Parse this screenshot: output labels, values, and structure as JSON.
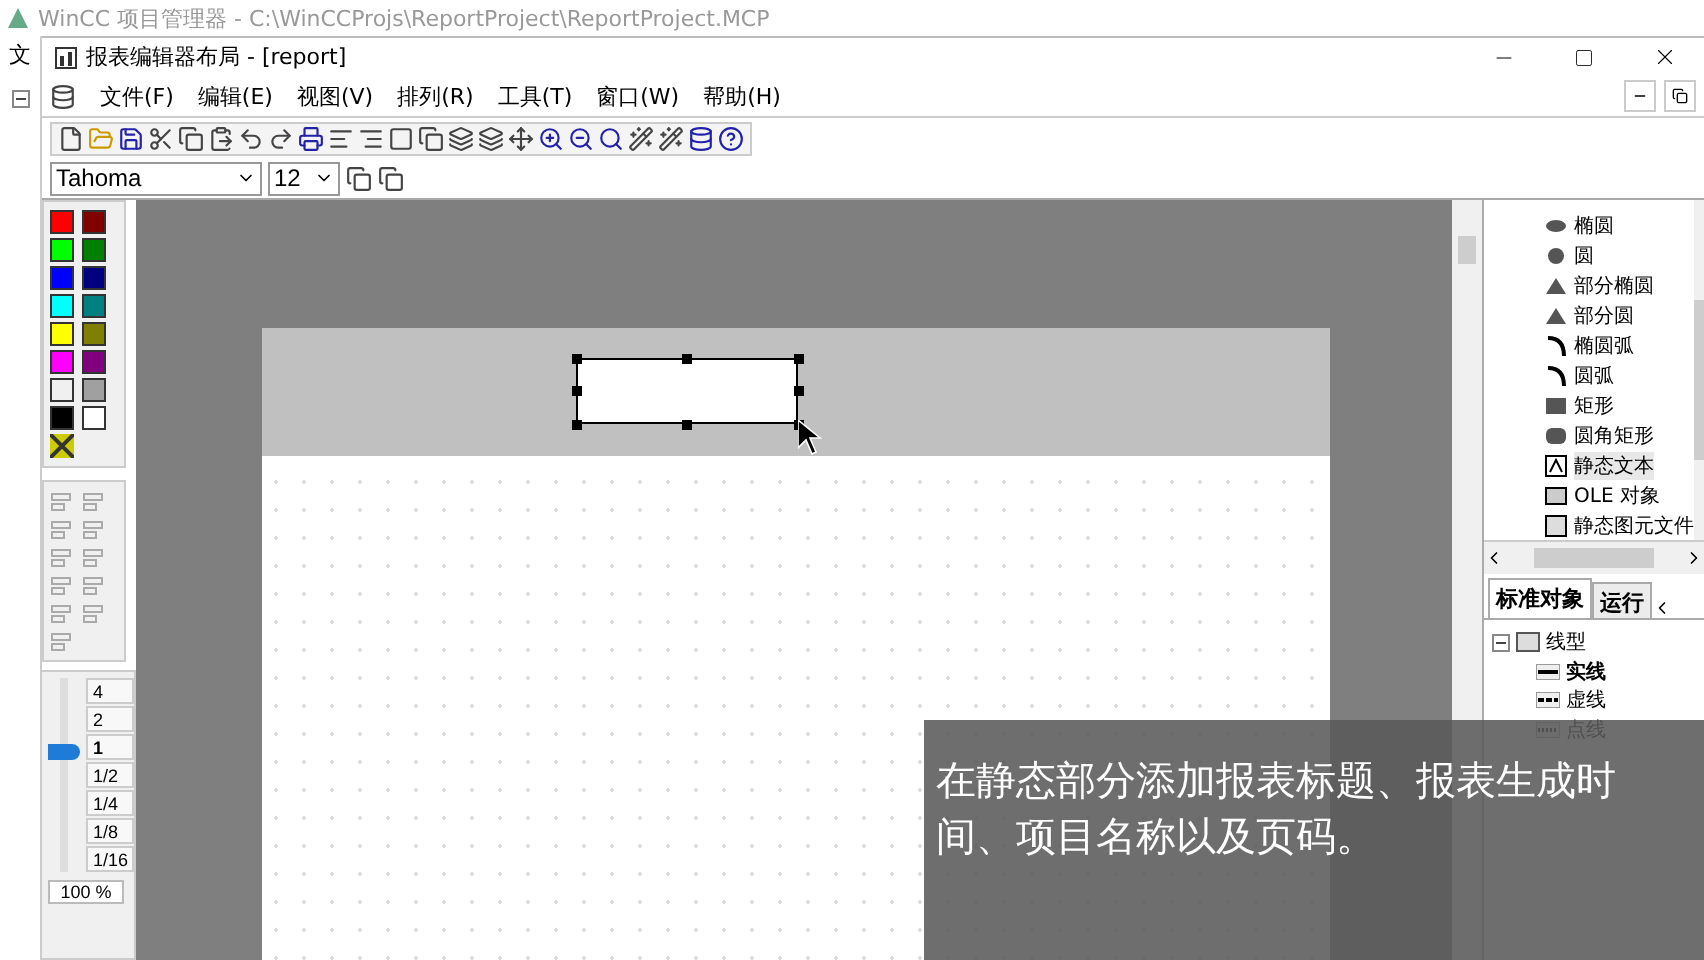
{
  "back_window": {
    "title": "WinCC 项目管理器 - C:\\WinCCProjs\\ReportProject\\ReportProject.MCP",
    "menu_fragment": "文"
  },
  "window": {
    "title": "报表编辑器布局 - [report]"
  },
  "menu": [
    "文件(F)",
    "编辑(E)",
    "视图(V)",
    "排列(R)",
    "工具(T)",
    "窗口(W)",
    "帮助(H)"
  ],
  "font_bar": {
    "font": "Tahoma",
    "size": "12"
  },
  "palette": [
    {
      "color": "#ff0000"
    },
    {
      "color": "#800000"
    },
    {
      "color": "#00ff00"
    },
    {
      "color": "#008000"
    },
    {
      "color": "#0000ff"
    },
    {
      "color": "#000080"
    },
    {
      "color": "#00ffff"
    },
    {
      "color": "#008080"
    },
    {
      "color": "#ffff00"
    },
    {
      "color": "#808000"
    },
    {
      "color": "#ff00ff"
    },
    {
      "color": "#800080"
    },
    {
      "color": "#f0f0f0"
    },
    {
      "color": "#a0a0a0"
    },
    {
      "color": "#000000"
    },
    {
      "color": "#ffffff"
    }
  ],
  "zoom": {
    "steps": [
      {
        "label": "4",
        "selected": false
      },
      {
        "label": "2",
        "selected": false
      },
      {
        "label": "1",
        "selected": true
      },
      {
        "label": "1/2",
        "selected": false
      },
      {
        "label": "1/4",
        "selected": false
      },
      {
        "label": "1/8",
        "selected": false
      },
      {
        "label": "1/16",
        "selected": false
      }
    ],
    "reading": "100 %"
  },
  "object_tree": [
    {
      "label": "椭圆",
      "selected": false
    },
    {
      "label": "圆",
      "selected": false
    },
    {
      "label": "部分椭圆",
      "selected": false
    },
    {
      "label": "部分圆",
      "selected": false
    },
    {
      "label": "椭圆弧",
      "selected": false
    },
    {
      "label": "圆弧",
      "selected": false
    },
    {
      "label": "矩形",
      "selected": false
    },
    {
      "label": "圆角矩形",
      "selected": false
    },
    {
      "label": "静态文本",
      "selected": true
    },
    {
      "label": "OLE 对象",
      "selected": false
    },
    {
      "label": "静态图元文件",
      "selected": false
    }
  ],
  "tabs": [
    {
      "label": "标准对象",
      "selected": true
    },
    {
      "label": "运行",
      "selected": false
    }
  ],
  "line_tree": [
    {
      "label": "线型",
      "expanded": true,
      "children": [
        {
          "label": "实线",
          "selected": true
        },
        {
          "label": "虚线",
          "selected": false
        },
        {
          "label": "点线",
          "selected": false
        }
      ]
    }
  ],
  "caption": "在静态部分添加报表标题、报表生成时间、项目名称以及页码。"
}
